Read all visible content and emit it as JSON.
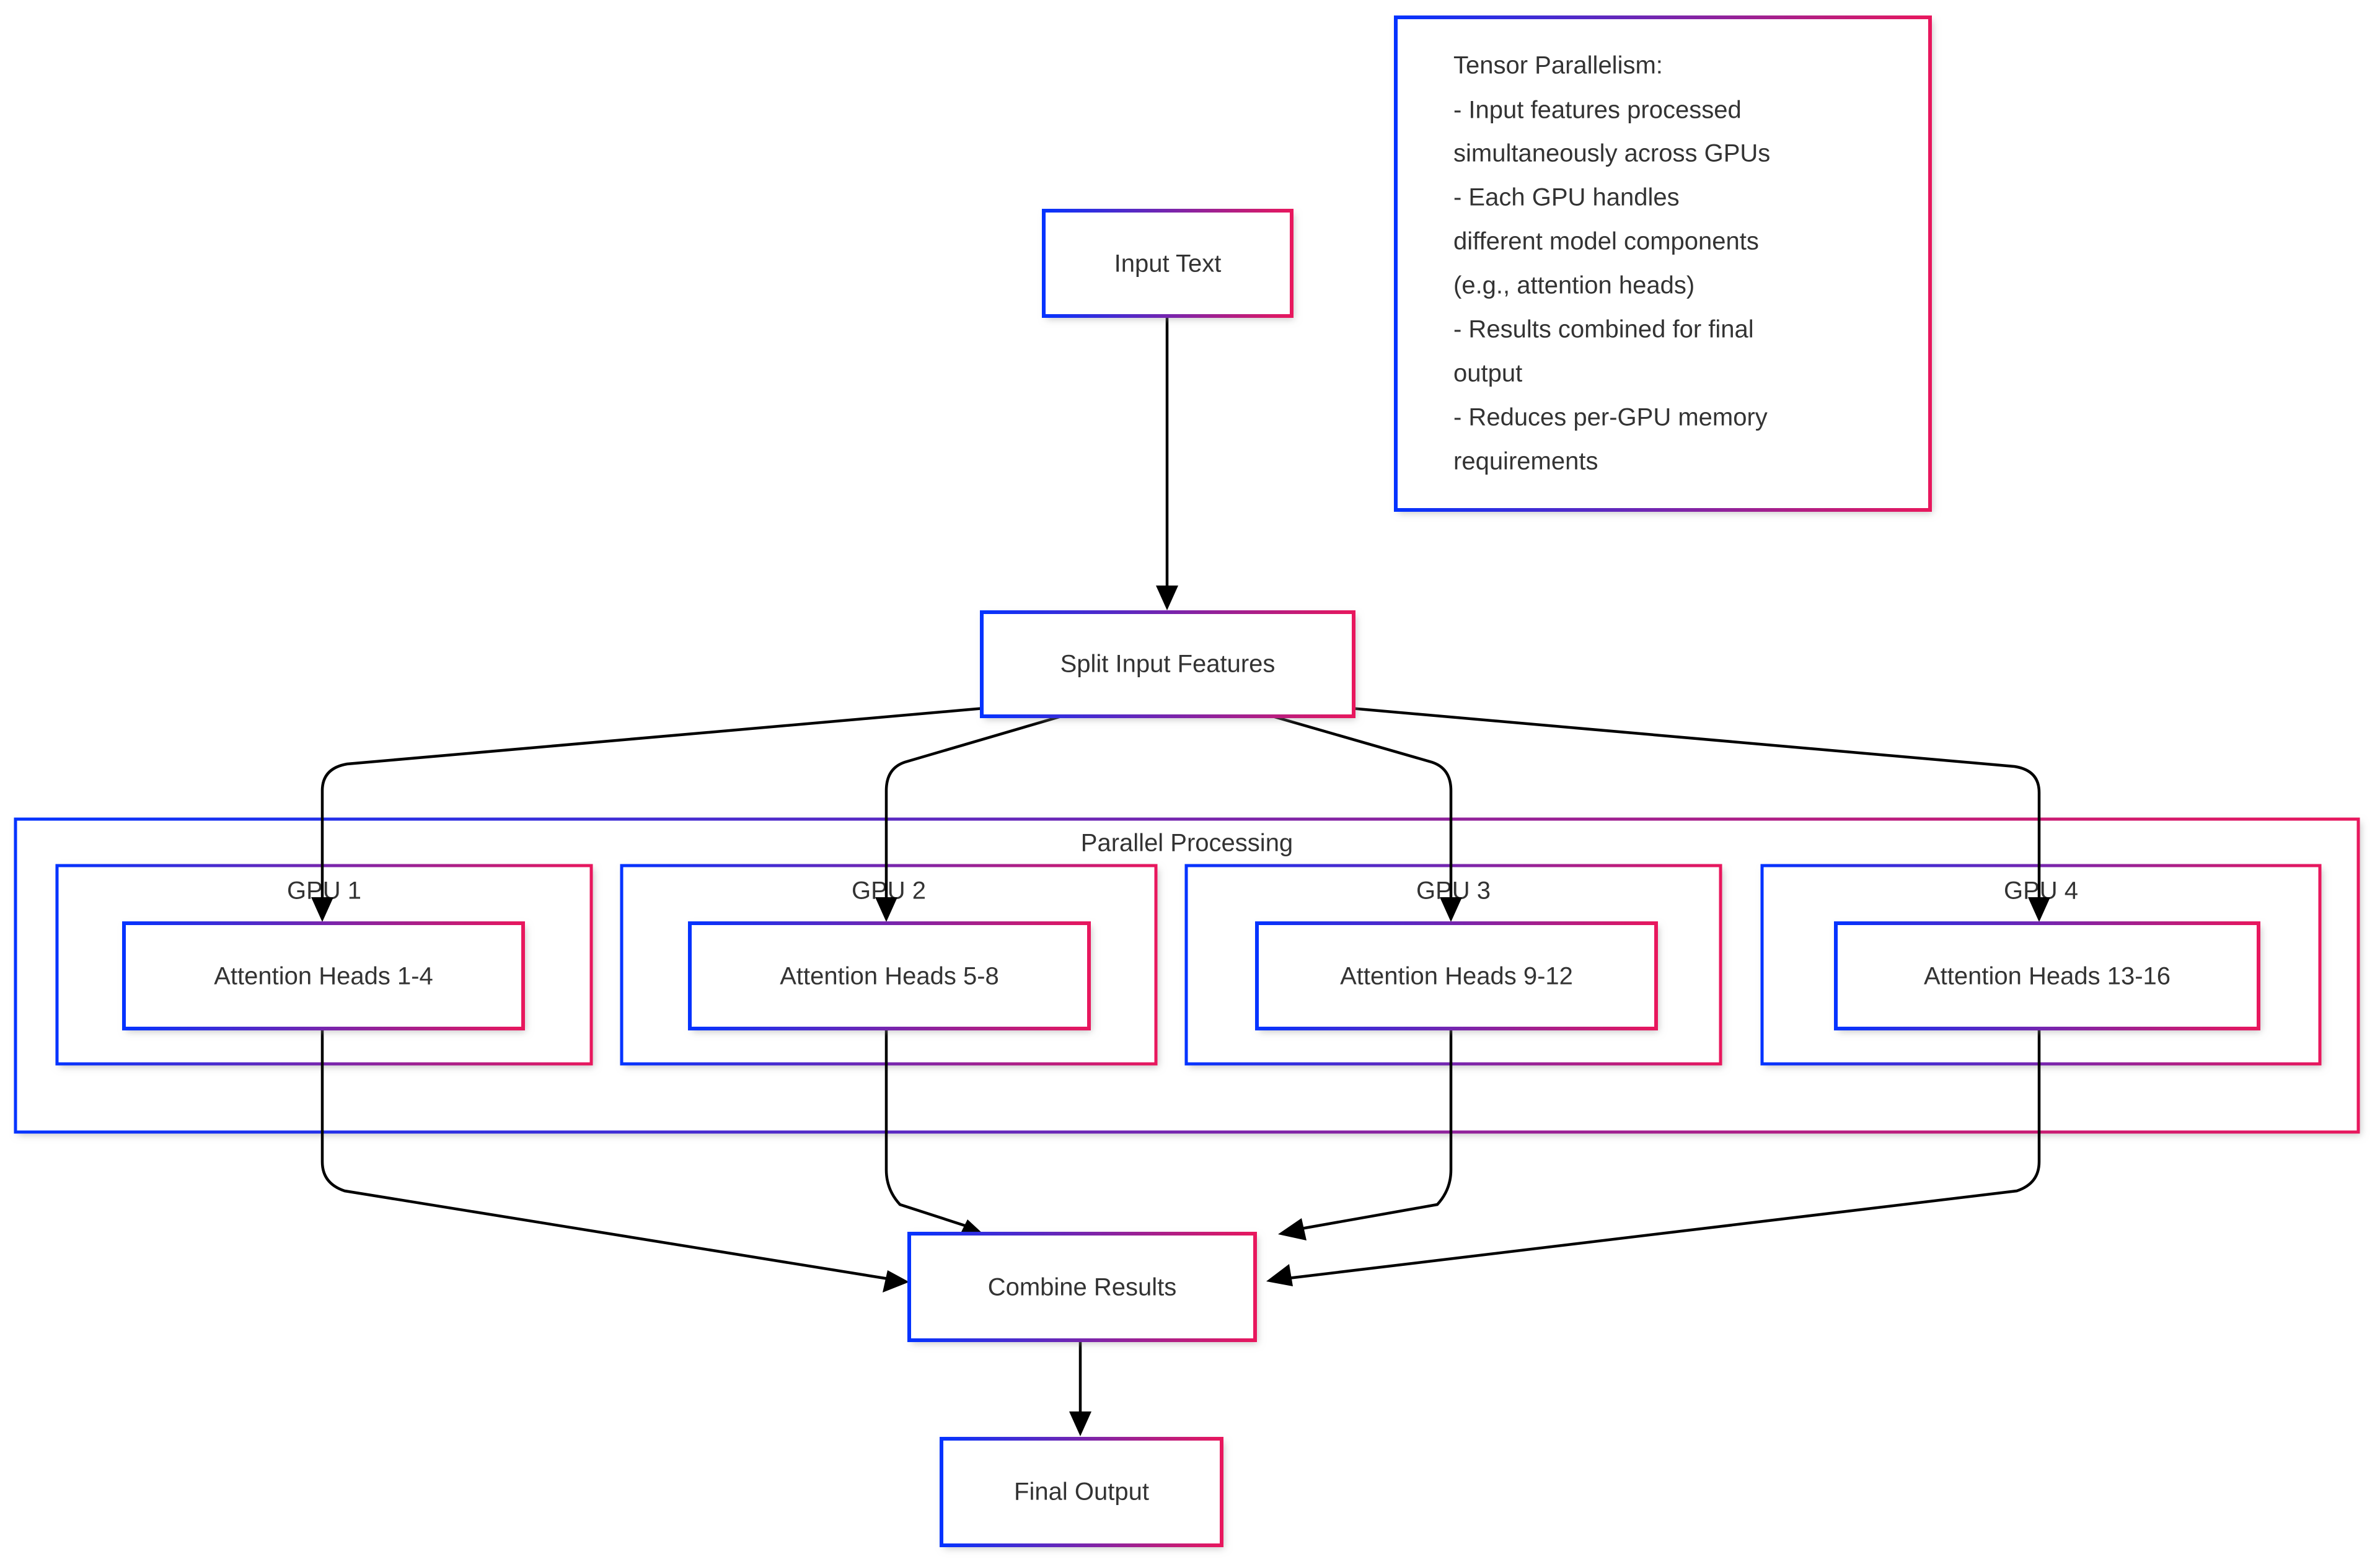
{
  "diagram": {
    "title": "Tensor Parallelism Flowchart",
    "colors": {
      "gradient_start": "#0433ff",
      "gradient_end": "#e8175d",
      "edge": "#000000",
      "text": "#333333",
      "background": "#ffffff"
    },
    "nodes": {
      "input_text": "Input Text",
      "split_input": "Split Input Features",
      "attention_1": "Attention Heads 1-4",
      "attention_2": "Attention Heads 5-8",
      "attention_3": "Attention Heads 9-12",
      "attention_4": "Attention Heads 13-16",
      "combine": "Combine Results",
      "final_output": "Final Output"
    },
    "clusters": {
      "parallel_processing": "Parallel Processing",
      "gpu_1": "GPU 1",
      "gpu_2": "GPU 2",
      "gpu_3": "GPU 3",
      "gpu_4": "GPU 4"
    },
    "note": {
      "lines": [
        "Tensor Parallelism:",
        "    - Input features processed",
        "simultaneously across GPUs",
        "    - Each GPU handles",
        "different model components",
        "(e.g., attention heads)",
        "    - Results combined for final",
        "output",
        "    - Reduces per-GPU memory",
        "requirements"
      ]
    }
  },
  "chart_data": {
    "type": "diagram",
    "title": "Tensor Parallelism",
    "nodes": [
      {
        "id": "input_text",
        "label": "Input Text"
      },
      {
        "id": "split_input",
        "label": "Split Input Features"
      },
      {
        "id": "attention_1",
        "label": "Attention Heads 1-4",
        "group": "GPU 1"
      },
      {
        "id": "attention_2",
        "label": "Attention Heads 5-8",
        "group": "GPU 2"
      },
      {
        "id": "attention_3",
        "label": "Attention Heads 9-12",
        "group": "GPU 3"
      },
      {
        "id": "attention_4",
        "label": "Attention Heads 13-16",
        "group": "GPU 4"
      },
      {
        "id": "combine",
        "label": "Combine Results"
      },
      {
        "id": "final_output",
        "label": "Final Output"
      }
    ],
    "edges": [
      {
        "from": "input_text",
        "to": "split_input"
      },
      {
        "from": "split_input",
        "to": "attention_1"
      },
      {
        "from": "split_input",
        "to": "attention_2"
      },
      {
        "from": "split_input",
        "to": "attention_3"
      },
      {
        "from": "split_input",
        "to": "attention_4"
      },
      {
        "from": "attention_1",
        "to": "combine"
      },
      {
        "from": "attention_2",
        "to": "combine"
      },
      {
        "from": "attention_3",
        "to": "combine"
      },
      {
        "from": "attention_4",
        "to": "combine"
      },
      {
        "from": "combine",
        "to": "final_output"
      }
    ],
    "groups": [
      "Parallel Processing",
      "GPU 1",
      "GPU 2",
      "GPU 3",
      "GPU 4"
    ]
  }
}
